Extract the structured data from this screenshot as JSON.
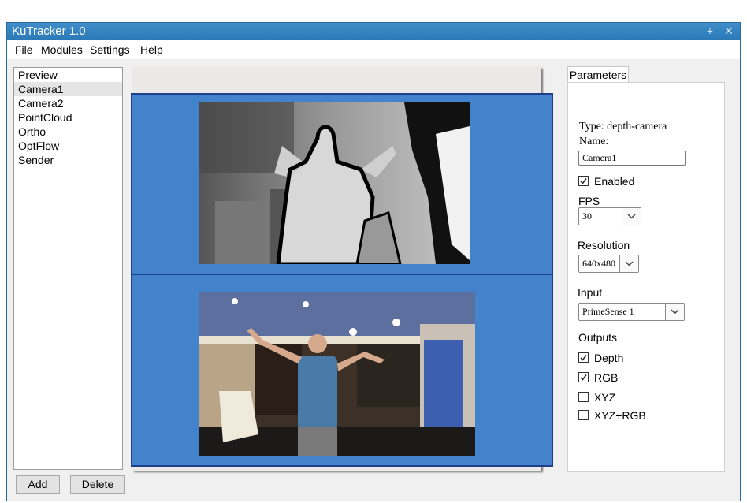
{
  "window": {
    "title": "KuTracker 1.0"
  },
  "menu": [
    "File",
    "Modules",
    "Settings",
    "Help"
  ],
  "modules": [
    "Preview",
    "Camera1",
    "Camera2",
    "PointCloud",
    "Ortho",
    "OptFlow",
    "Sender"
  ],
  "buttons": {
    "add": "Add",
    "delete": "Delete"
  },
  "parameters": {
    "tab": "Parameters",
    "type": "Type: depth-camera",
    "name_label": "Name:",
    "name_value": "Camera1",
    "enabled_label": "Enabled",
    "enabled": true,
    "fps_label": "FPS",
    "fps_value": "30",
    "resolution_label": "Resolution",
    "resolution_value": "640x480",
    "input_label": "Input",
    "input_value": "PrimeSense 1",
    "outputs_label": "Outputs",
    "outputs": [
      {
        "label": "Depth",
        "checked": true
      },
      {
        "label": "RGB",
        "checked": true
      },
      {
        "label": "XYZ",
        "checked": false
      },
      {
        "label": "XYZ+RGB",
        "checked": false
      }
    ]
  },
  "colors": {
    "titlebar": "#2b79b6",
    "viewport": "#4283cb",
    "viewport_border": "#1e3f8a"
  },
  "icons": [
    "minimize-icon",
    "maximize-icon",
    "close-icon",
    "chevron-down-icon",
    "check-icon"
  ]
}
